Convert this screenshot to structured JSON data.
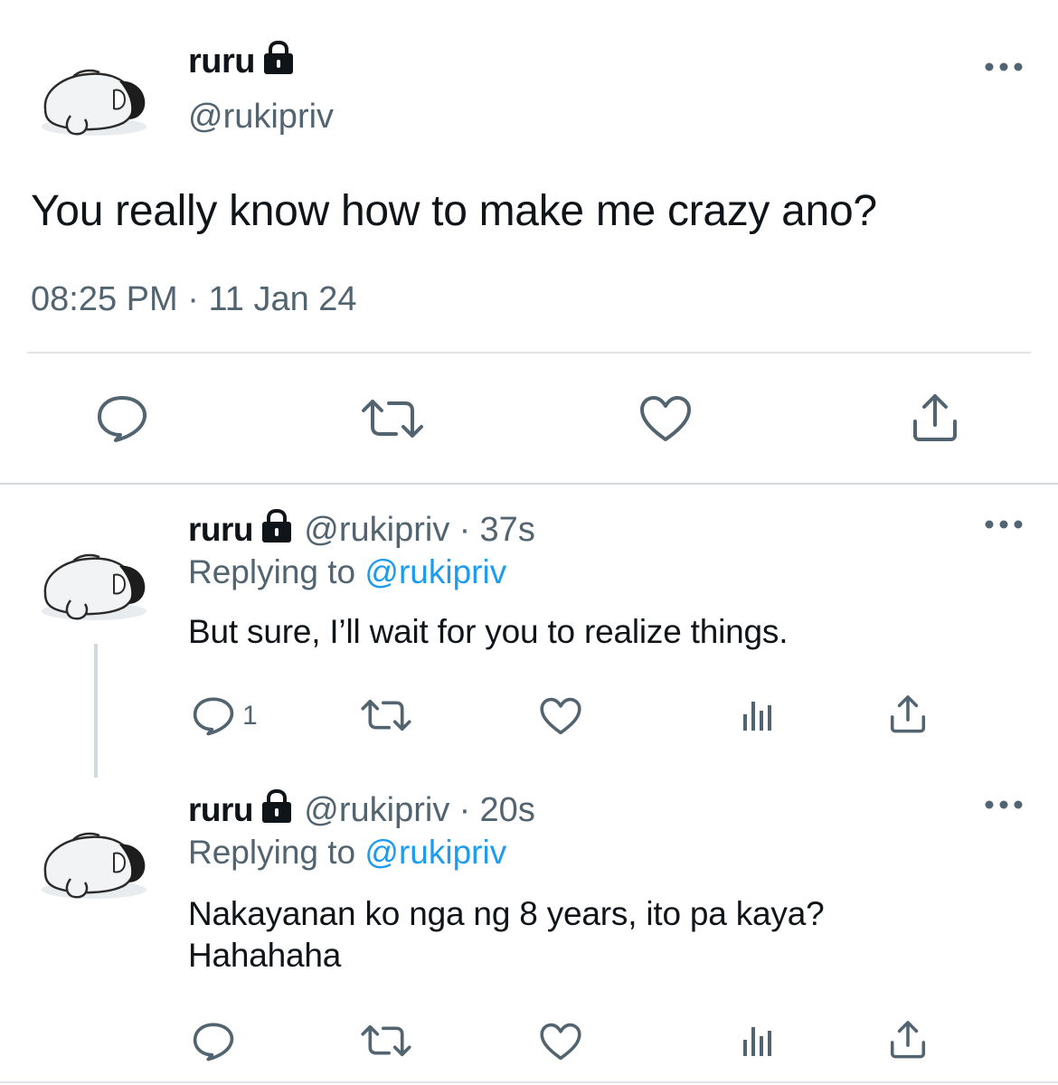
{
  "main_tweet": {
    "display_name": "ruru",
    "handle": "@rukipriv",
    "text": "You really know how to make me crazy ano?",
    "timestamp": "08:25 PM",
    "date": "11 Jan 24",
    "separator": "·",
    "actions": [
      "reply-icon",
      "retweet-icon",
      "like-icon",
      "share-icon"
    ]
  },
  "replies": [
    {
      "display_name": "ruru",
      "handle": "@rukipriv",
      "separator": "·",
      "time_ago": "37s",
      "replying_prefix": "Replying to",
      "replying_to": "@rukipriv",
      "text": "But sure, I’ll wait for you to realize things.",
      "reply_count": "1"
    },
    {
      "display_name": "ruru",
      "handle": "@rukipriv",
      "separator": "·",
      "time_ago": "20s",
      "replying_prefix": "Replying to",
      "replying_to": "@rukipriv",
      "text_line1": "Nakayanan ko nga ng 8 years, ito pa kaya?",
      "text_line2": "Hahahaha",
      "reply_count": ""
    }
  ],
  "colors": {
    "text": "#0f1419",
    "secondary": "#536471",
    "link": "#1d9bf0",
    "divider": "#e1e4e8"
  }
}
